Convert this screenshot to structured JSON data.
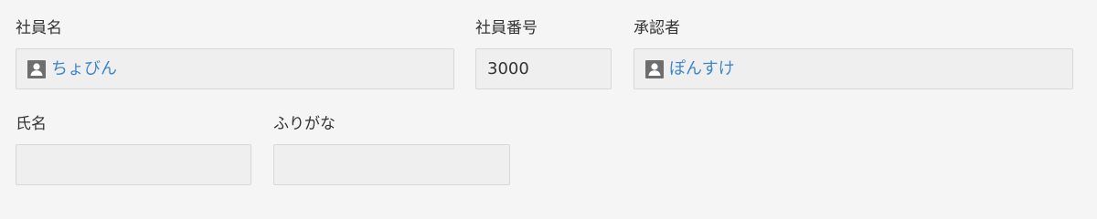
{
  "form": {
    "employee_name": {
      "label": "社員名",
      "value": "ちょびん",
      "icon": "user-icon"
    },
    "employee_number": {
      "label": "社員番号",
      "value": "3000"
    },
    "approver": {
      "label": "承認者",
      "value": "ぽんすけ",
      "icon": "user-icon"
    },
    "full_name": {
      "label": "氏名",
      "value": ""
    },
    "furigana": {
      "label": "ふりがな",
      "value": ""
    }
  },
  "colors": {
    "background": "#f5f5f5",
    "field_background": "#efefef",
    "field_border": "#d8d8d8",
    "link": "#3f87c6",
    "text": "#333333",
    "icon": "#6e6e6e"
  }
}
